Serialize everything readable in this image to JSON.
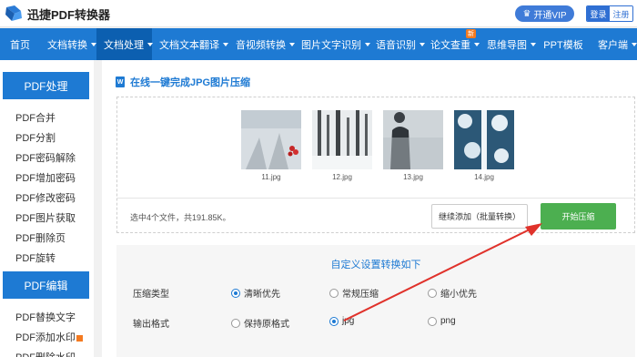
{
  "header": {
    "app_name": "迅捷PDF转换器",
    "vip_label": "开通VIP",
    "login_label": "登录",
    "register_label": "注册"
  },
  "nav": {
    "items": [
      {
        "label": "首页",
        "dropdown": false
      },
      {
        "label": "文档转换",
        "dropdown": true
      },
      {
        "label": "文档处理",
        "dropdown": true,
        "active": true
      },
      {
        "label": "文档文本翻译",
        "dropdown": true
      },
      {
        "label": "音视频转换",
        "dropdown": true
      },
      {
        "label": "图片文字识别",
        "dropdown": true
      },
      {
        "label": "语音识别",
        "dropdown": true
      },
      {
        "label": "论文查重",
        "dropdown": true,
        "badge": "新"
      },
      {
        "label": "思维导图",
        "dropdown": true
      },
      {
        "label": "PPT模板",
        "dropdown": false
      },
      {
        "label": "客户端",
        "dropdown": true
      }
    ]
  },
  "sidebar": {
    "group1_title": "PDF处理",
    "group1_items": [
      "PDF合并",
      "PDF分割",
      "PDF密码解除",
      "PDF增加密码",
      "PDF修改密码",
      "PDF图片获取",
      "PDF删除页",
      "PDF旋转"
    ],
    "group2_title": "PDF编辑",
    "group2_items": [
      "PDF替换文字",
      "PDF添加水印",
      "PDF删除水印"
    ]
  },
  "main": {
    "section_title": "在线一键完成JPG图片压缩",
    "files": [
      {
        "name": "11.jpg"
      },
      {
        "name": "12.jpg"
      },
      {
        "name": "13.jpg"
      },
      {
        "name": "14.jpg"
      }
    ],
    "summary": "选中4个文件，共191.85K。",
    "continue_label": "继续添加（批量转换）",
    "start_label": "开始压缩"
  },
  "settings": {
    "title": "自定义设置转换如下",
    "compression_label": "压缩类型",
    "compression_options": [
      {
        "label": "清晰优先",
        "checked": true
      },
      {
        "label": "常规压缩",
        "checked": false
      },
      {
        "label": "缩小优先",
        "checked": false
      }
    ],
    "format_label": "输出格式",
    "format_options": [
      {
        "label": "保持原格式",
        "checked": false
      },
      {
        "label": "jpg",
        "checked": true
      },
      {
        "label": "png",
        "checked": false
      }
    ]
  },
  "colors": {
    "brand_blue": "#1e7ad3",
    "start_green": "#4caf50",
    "annotation_red": "#e0322b"
  }
}
